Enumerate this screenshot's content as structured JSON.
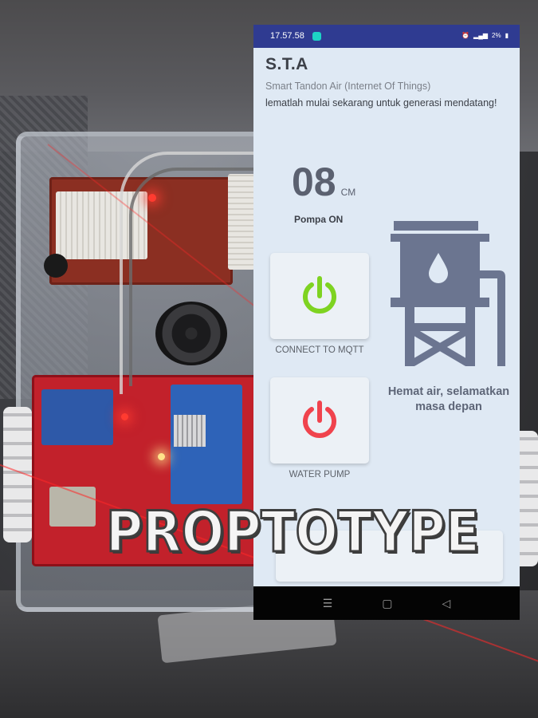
{
  "status_bar": {
    "time": "17.57.58",
    "battery": "2%",
    "icons": [
      "chat-notification-icon",
      "alarm-icon",
      "signal-icon",
      "battery-icon"
    ]
  },
  "app": {
    "title": "S.T.A",
    "subtitle": "Smart Tandon Air (Internet Of Things)",
    "slogan": "lematlah mulai sekarang untuk generasi mendatang!",
    "distance_value": "08",
    "distance_unit": "CM",
    "pump_status": "Pompa ON",
    "mqtt_label": "CONNECT TO MQTT",
    "pump_label": "WATER PUMP",
    "tank_caption": "Hemat air, selamatkan masa depan",
    "colors": {
      "status_bar": "#2f3b91",
      "background": "#dfe9f4",
      "mqtt_power": "#7ed321",
      "pump_power": "#f0434d",
      "tank_icon": "#6b7590"
    }
  },
  "nav": {
    "recent": "☰",
    "home": "▢",
    "back": "◁"
  },
  "overlay": {
    "text": "PROPTOTYPE"
  }
}
